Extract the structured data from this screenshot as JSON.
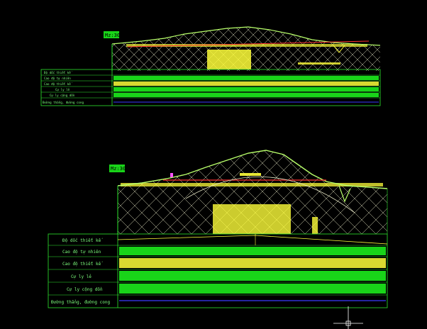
{
  "colors": {
    "background": "#000000",
    "frame": "#2ee62e",
    "terrain": "#b8ff6a",
    "hatch": "#e8e8c8",
    "yellow": "#ffff3a",
    "green_fill": "#19d419",
    "red": "#ff3030",
    "magenta": "#ff55ff",
    "blue": "#3a3aff",
    "crosshair": "#ffffff"
  },
  "drawings": [
    {
      "scale_tag": "Mz:30",
      "rows": [
        "Ðộ dốc thiết kế",
        "Cao độ tự nhiên",
        "Cao độ thiết kế",
        "Cự ly lẻ",
        "Cự ly cộng dồn",
        "Đường thẳng, đường cong"
      ]
    },
    {
      "scale_tag": "Mz:30",
      "rows": [
        "Ðộ dốc thiết kế",
        "Cao độ tự nhiên",
        "Cao độ thiết kế",
        "Cự ly lẻ",
        "Cự ly cộng dồn",
        "Đường thẳng, đường cong"
      ]
    }
  ],
  "cursor_icon": "crosshair-cursor-icon"
}
